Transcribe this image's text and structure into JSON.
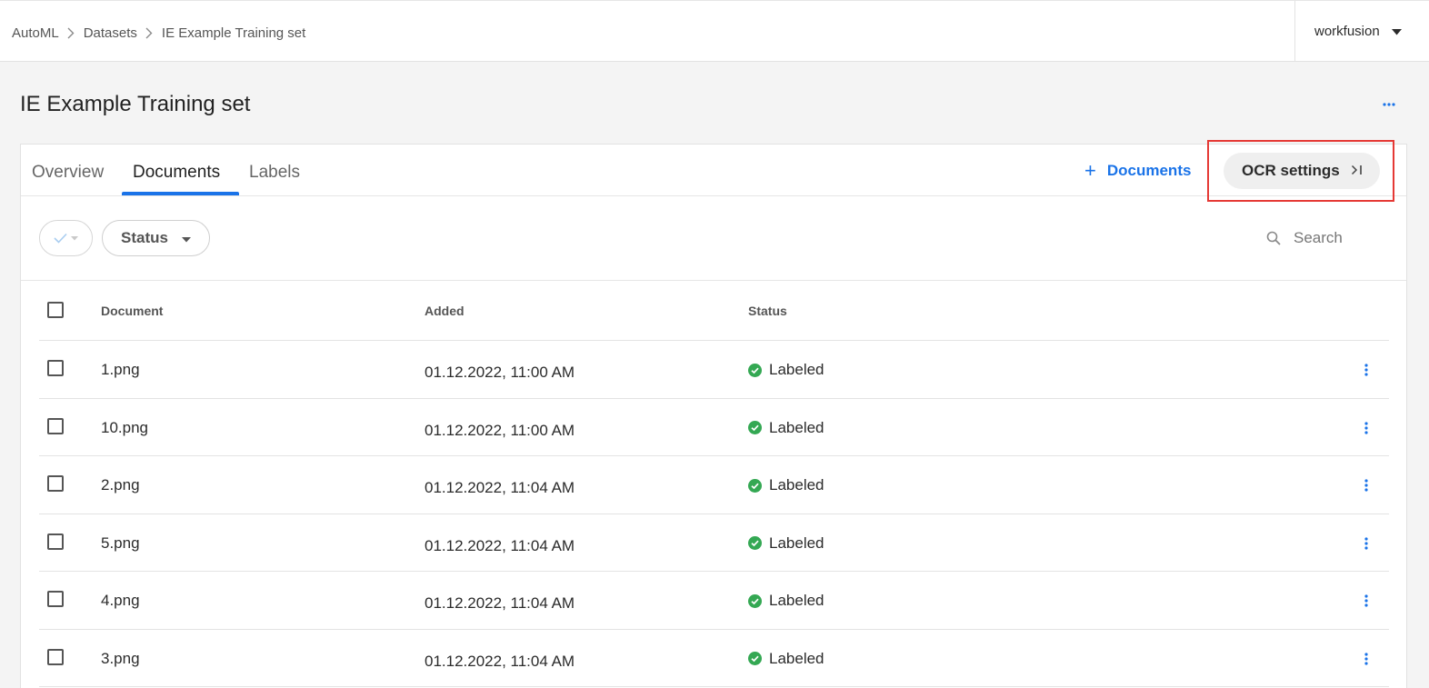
{
  "breadcrumb": {
    "items": [
      "AutoML",
      "Datasets",
      "IE Example Training set"
    ]
  },
  "account": {
    "name": "workfusion"
  },
  "page": {
    "title": "IE Example Training set"
  },
  "tabs": [
    {
      "label": "Overview",
      "active": false
    },
    {
      "label": "Documents",
      "active": true
    },
    {
      "label": "Labels",
      "active": false
    }
  ],
  "actions": {
    "add_documents_label": "Documents",
    "ocr_settings_label": "OCR settings"
  },
  "filters": {
    "status_label": "Status",
    "search_placeholder": "Search"
  },
  "table": {
    "columns": [
      "Document",
      "Added",
      "Status"
    ],
    "rows": [
      {
        "document": "1.png",
        "added": "01.12.2022, 11:00 AM",
        "status": "Labeled"
      },
      {
        "document": "10.png",
        "added": "01.12.2022, 11:00 AM",
        "status": "Labeled"
      },
      {
        "document": "2.png",
        "added": "01.12.2022, 11:04 AM",
        "status": "Labeled"
      },
      {
        "document": "5.png",
        "added": "01.12.2022, 11:04 AM",
        "status": "Labeled"
      },
      {
        "document": "4.png",
        "added": "01.12.2022, 11:04 AM",
        "status": "Labeled"
      },
      {
        "document": "3.png",
        "added": "01.12.2022, 11:04 AM",
        "status": "Labeled"
      }
    ]
  },
  "colors": {
    "accent": "#1a73e8",
    "status_success": "#34a853",
    "highlight": "#e53935"
  },
  "icons": [
    "chevron-right-icon",
    "caret-down-icon",
    "more-horizontal-icon",
    "plus-icon",
    "collapse-right-icon",
    "check-icon",
    "search-icon",
    "check-circle-icon",
    "more-vertical-icon"
  ]
}
